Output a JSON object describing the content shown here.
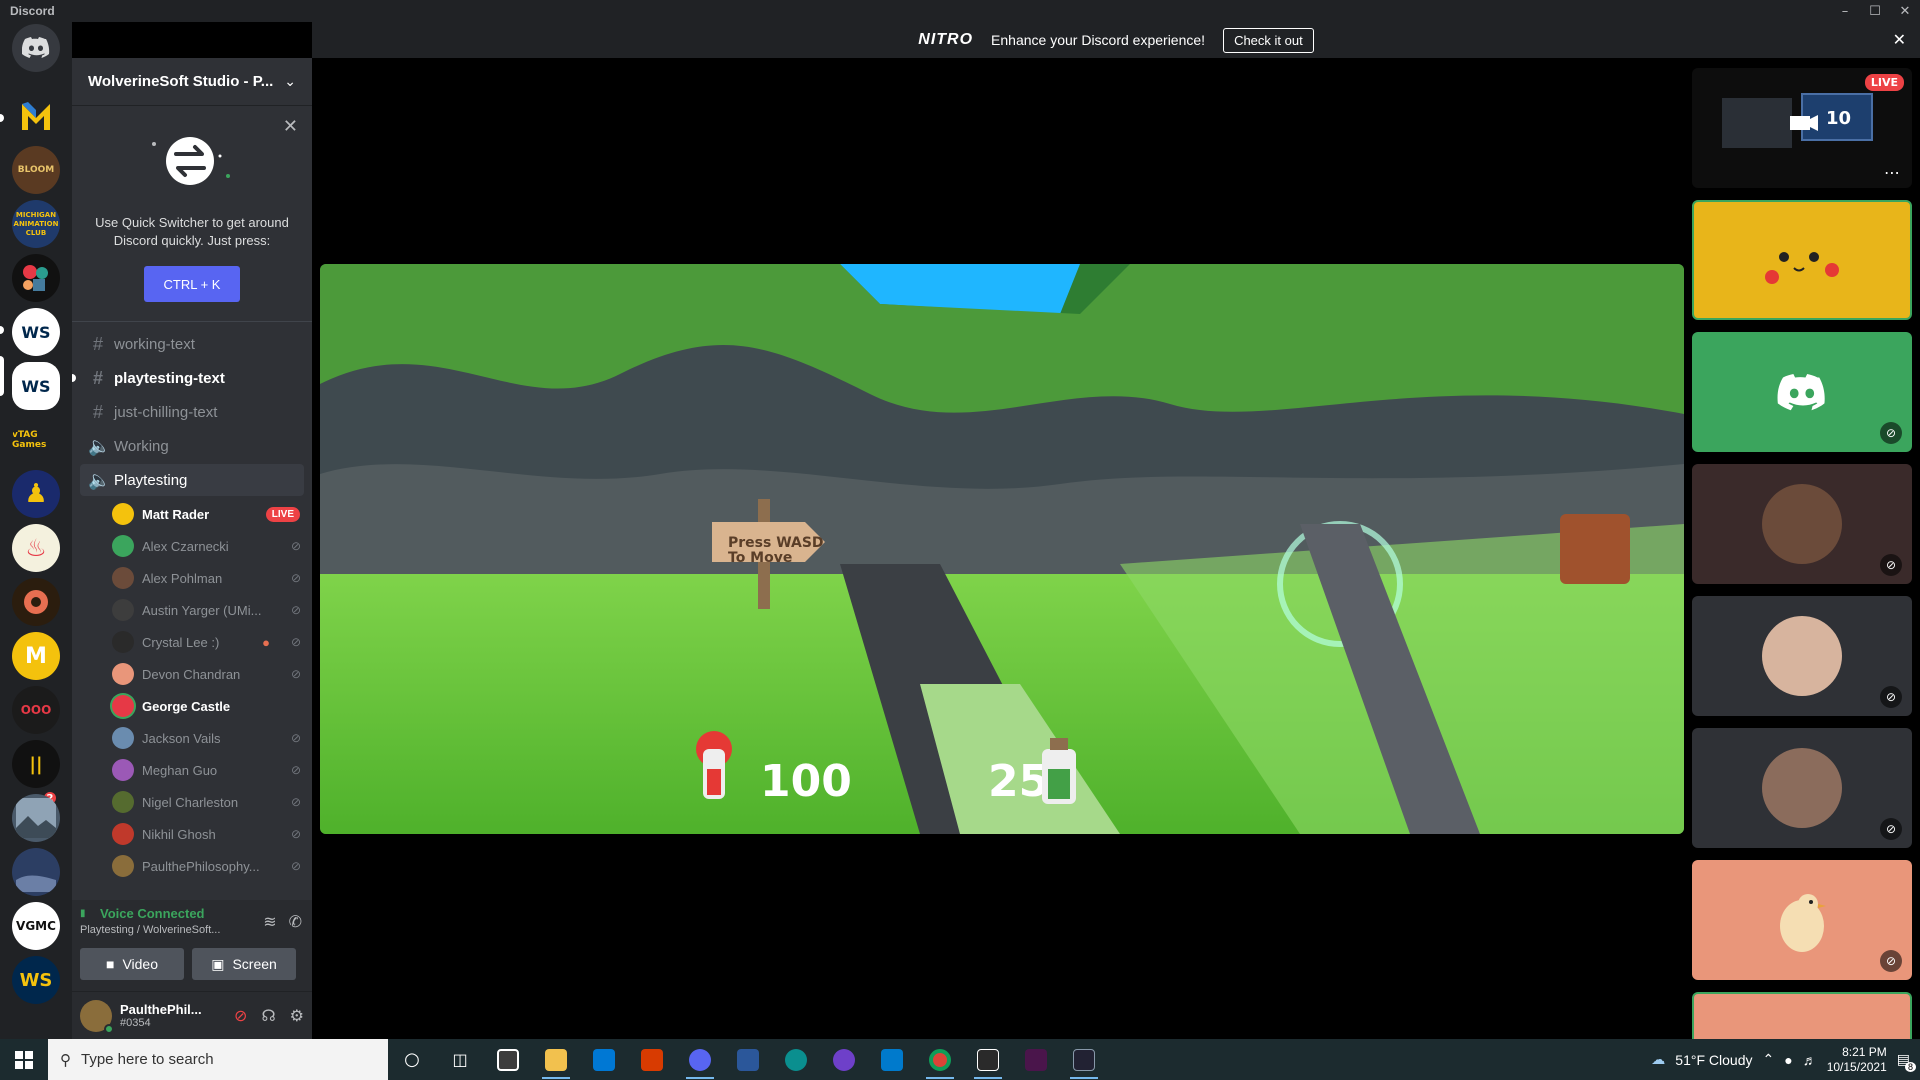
{
  "window": {
    "title": "Discord"
  },
  "nitro_banner": {
    "logo": "NITRO",
    "text": "Enhance your Discord experience!",
    "button": "Check it out"
  },
  "guild": {
    "name": "WolverineSoft Studio - P..."
  },
  "quick_switcher": {
    "text": "Use Quick Switcher to get around Discord quickly. Just press:",
    "button": "CTRL + K"
  },
  "channels": [
    {
      "name": "working-text",
      "type": "text"
    },
    {
      "name": "playtesting-text",
      "type": "text"
    },
    {
      "name": "just-chilling-text",
      "type": "text"
    },
    {
      "name": "Working",
      "type": "voice"
    },
    {
      "name": "Playtesting",
      "type": "voice"
    }
  ],
  "members": [
    {
      "name": "Matt Rader",
      "badge": "LIVE"
    },
    {
      "name": "Alex Czarnecki"
    },
    {
      "name": "Alex Pohlman"
    },
    {
      "name": "Austin Yarger (UMi..."
    },
    {
      "name": "Crystal Lee :)"
    },
    {
      "name": "Devon Chandran"
    },
    {
      "name": "George Castle"
    },
    {
      "name": "Jackson Vails"
    },
    {
      "name": "Meghan Guo"
    },
    {
      "name": "Nigel Charleston"
    },
    {
      "name": "Nikhil Ghosh"
    },
    {
      "name": "PaulthePhilosophy..."
    }
  ],
  "voice": {
    "status": "Voice Connected",
    "location": "Playtesting / WolverineSoft...",
    "video_label": "Video",
    "screen_label": "Screen"
  },
  "user": {
    "name": "PaulthePhil...",
    "tag": "#0354"
  },
  "stream": {
    "sign": "Press WASD\nTo Move",
    "health": "100",
    "mana": "25"
  },
  "tiles": {
    "live_label": "LIVE",
    "stream_number": "10"
  },
  "servers": {
    "badge_count": "2"
  },
  "taskbar": {
    "search_placeholder": "Type here to search",
    "weather": "51°F  Cloudy",
    "time": "8:21 PM",
    "date": "10/15/2021",
    "notif_count": "8"
  },
  "colors": {
    "blurple": "#5865f2",
    "live": "#ed4245",
    "connected": "#3ba55d",
    "sidebar": "#2f3136",
    "rail": "#202225"
  }
}
